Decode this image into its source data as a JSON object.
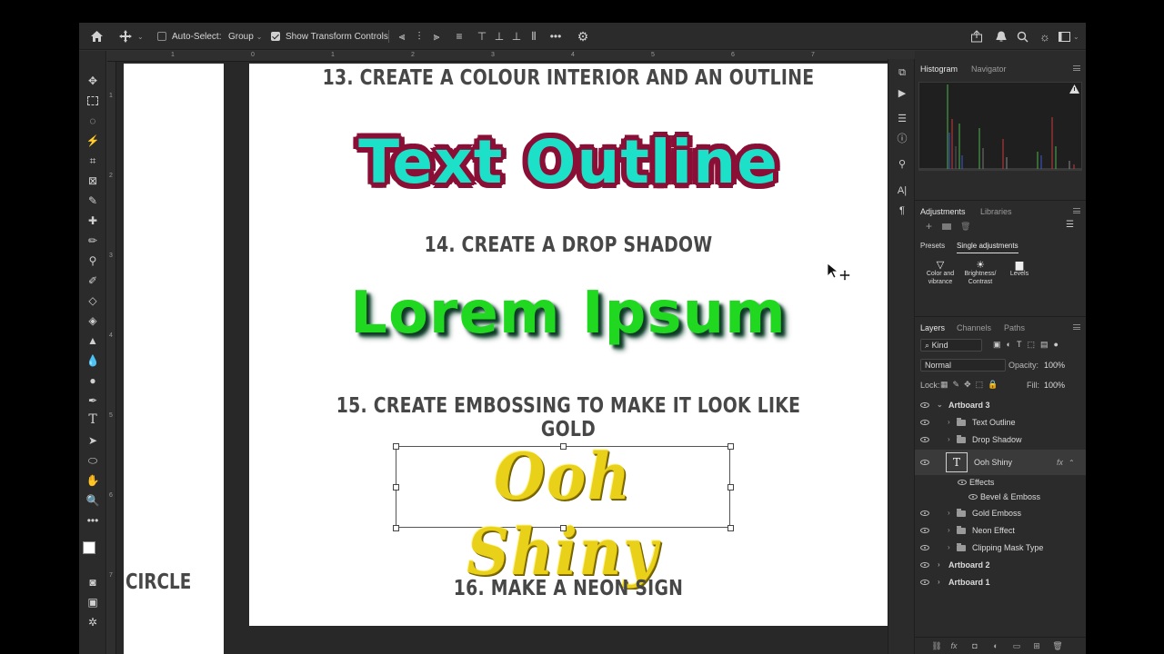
{
  "optbar": {
    "auto_select_label": "Auto-Select:",
    "group_value": "Group",
    "show_transform_label": "Show Transform Controls"
  },
  "rulers": {
    "h_ticks": [
      "1",
      "0",
      "1",
      "2",
      "3",
      "4",
      "5",
      "6",
      "7"
    ],
    "v_ticks": [
      "1",
      "2",
      "3",
      "4",
      "5",
      "6",
      "7"
    ]
  },
  "canvas": {
    "heading13": "13. CREATE A COLOUR INTERIOR AND AN OUTLINE",
    "outline_text": "Text Outline",
    "heading14": "14. CREATE A DROP SHADOW",
    "shadow_text": "Lorem Ipsum",
    "heading15": "15. CREATE EMBOSSING TO MAKE IT LOOK LIKE GOLD",
    "gold_text": "Ooh Shiny",
    "heading16": "16. MAKE A NEON SIGN",
    "circle_label": "CIRCLE"
  },
  "histogram_panel": {
    "tab_histogram": "Histogram",
    "tab_navigator": "Navigator"
  },
  "adjustments_panel": {
    "tab_adjustments": "Adjustments",
    "tab_libraries": "Libraries",
    "sub_presets": "Presets",
    "sub_single": "Single adjustments",
    "items": [
      {
        "line1": "Color and",
        "line2": "vibrance"
      },
      {
        "line1": "Brightness/",
        "line2": "Contrast"
      },
      {
        "line1": "Levels",
        "line2": ""
      }
    ]
  },
  "layers_panel": {
    "tab_layers": "Layers",
    "tab_channels": "Channels",
    "tab_paths": "Paths",
    "kind_label": "Kind",
    "blend_mode": "Normal",
    "opacity_label": "Opacity:",
    "opacity_value": "100%",
    "lock_label": "Lock:",
    "fill_label": "Fill:",
    "fill_value": "100%",
    "layers": {
      "artboard3": "Artboard 3",
      "text_outline": "Text Outline",
      "drop_shadow": "Drop Shadow",
      "ooh_shiny": "Ooh Shiny",
      "effects": "Effects",
      "bevel_emboss": "Bevel & Emboss",
      "gold_emboss": "Gold Emboss",
      "neon_effect": "Neon Effect",
      "clipping_mask": "Clipping Mask Type",
      "artboard2": "Artboard 2",
      "artboard1": "Artboard 1"
    }
  },
  "colors": {
    "outline_fill": "#1de0c8",
    "outline_stroke": "#8a0f36",
    "shadow_text": "#1fd81f",
    "gold": "#e9d11a"
  }
}
